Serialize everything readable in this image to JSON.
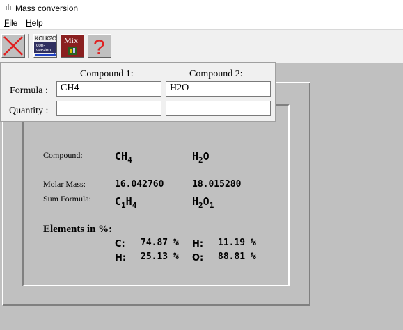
{
  "window": {
    "title": "Mass conversion"
  },
  "menu": {
    "file": "File",
    "help": "Help"
  },
  "toolbar": {
    "conversion_icon_text": [
      "KCl K2O",
      "con-",
      "version"
    ],
    "mix_icon_text": "Mix",
    "help_icon_text": "?"
  },
  "input": {
    "compound1_header": "Compound 1:",
    "compound2_header": "Compound 2:",
    "formula_label": "Formula :",
    "quantity_label": "Quantity :",
    "compound1_formula": "CH4",
    "compound2_formula": "H2O",
    "compound1_quantity": "",
    "compound2_quantity": ""
  },
  "results": {
    "compound_label": "Compound:",
    "molar_mass_label": "Molar Mass:",
    "sum_formula_label": "Sum Formula:",
    "elements_heading": "Elements in %:",
    "compound1": {
      "formula": [
        {
          "el": "C",
          "n": ""
        },
        {
          "el": "H",
          "n": "4"
        }
      ],
      "molar_mass": "16.042760",
      "sum_formula": [
        {
          "el": "C",
          "n": "1"
        },
        {
          "el": "H",
          "n": "4"
        }
      ],
      "elements": [
        {
          "symbol": "C:",
          "percent": "74.87 %"
        },
        {
          "symbol": "H:",
          "percent": "25.13 %"
        }
      ]
    },
    "compound2": {
      "formula": [
        {
          "el": "H",
          "n": "2"
        },
        {
          "el": "O",
          "n": ""
        }
      ],
      "molar_mass": "18.015280",
      "sum_formula": [
        {
          "el": "H",
          "n": "2"
        },
        {
          "el": "O",
          "n": "1"
        }
      ],
      "elements": [
        {
          "symbol": "H:",
          "percent": "11.19 %"
        },
        {
          "symbol": "O:",
          "percent": "88.81 %"
        }
      ]
    }
  },
  "colors": {
    "background": "#c0c0c0",
    "close_red": "#e02020",
    "help_red": "#e02020"
  }
}
